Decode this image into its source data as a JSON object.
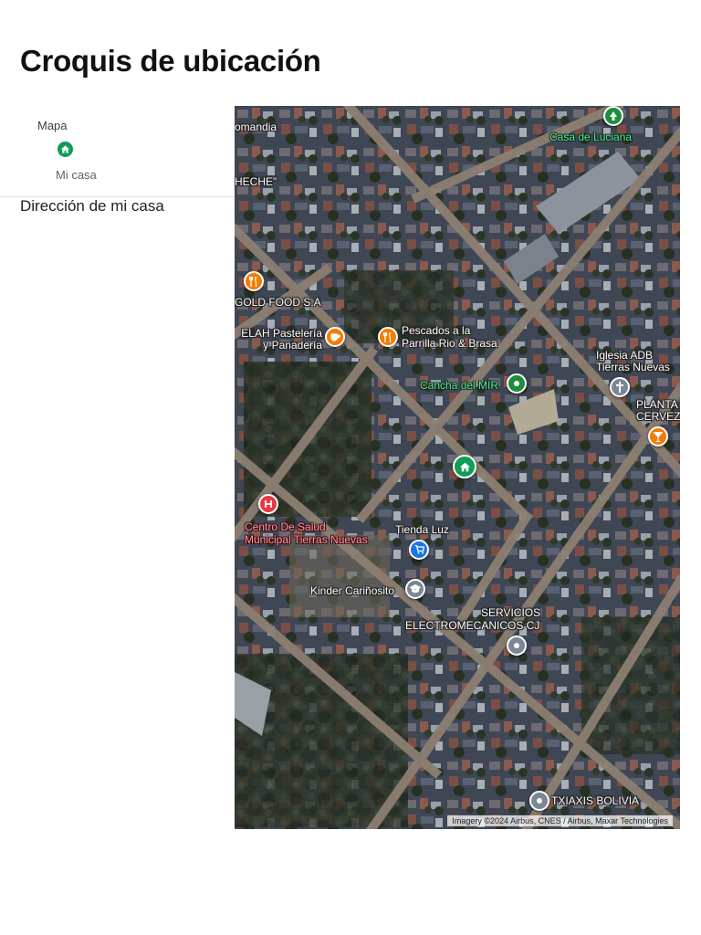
{
  "page": {
    "title": "Croquis de ubicación",
    "address_label": "Dirección de mi casa"
  },
  "legend": {
    "heading": "Mapa",
    "items": [
      {
        "label": "Mi casa",
        "icon": "home-icon",
        "color": "#0f9d58"
      }
    ]
  },
  "map": {
    "attribution": "Imagery ©2024 Airbus, CNES / Airbus, Maxar Technologies",
    "places": {
      "comandancia": "omandia",
      "cheche": "HECHE\"",
      "casa_luciana": "Casa de Luciana",
      "gold_food": "GOLD FOOD S.A",
      "elah_l1": "ELAH Pastelería",
      "elah_l2": "y Panadería",
      "pescados_l1": "Pescados a la",
      "pescados_l2": "Parrilla Rio & Brasa",
      "iglesia_l1": "Iglesia ADB",
      "iglesia_l2": "Tierras Nuevas",
      "cancha": "Cancha del MIR",
      "planta_l1": "PLANTA",
      "planta_l2": "CERVEZA",
      "salud_l1": "Centro De Salud",
      "salud_l2": "Municipal Tierras Nuevas",
      "tienda": "Tienda Luz",
      "kinder": "Kinder Cariñosito",
      "servicios_l1": "SERVICIOS",
      "servicios_l2": "ELECTROMECANICOS CJ",
      "txiaxis": "TXIAXIS BOLIVIA"
    },
    "colors": {
      "home": "#0f9d58",
      "park": "#1e8e3e",
      "food": "#f57c00",
      "health": "#e53945",
      "shopping": "#1a73e8",
      "generic": "#7b8794"
    }
  }
}
